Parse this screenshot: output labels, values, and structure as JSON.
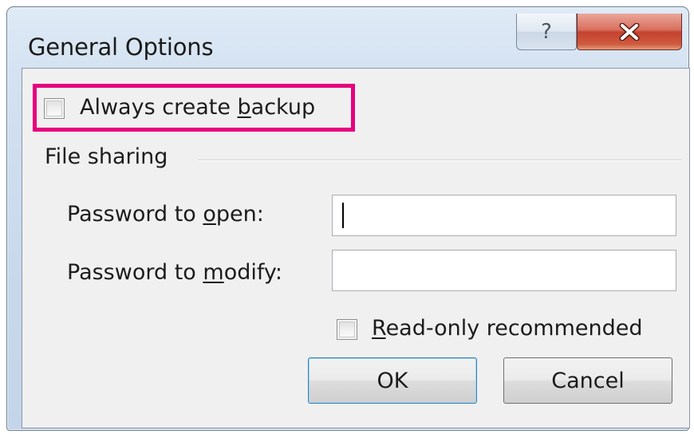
{
  "window": {
    "title": "General Options",
    "help_glyph": "?",
    "close_icon": "close-icon"
  },
  "backup": {
    "label_pre": "Always create ",
    "label_accel": "b",
    "label_post": "ackup",
    "checked": false,
    "highlight_color": "#e6007e"
  },
  "file_sharing": {
    "group_label": "File sharing",
    "password_open": {
      "label_pre": "Password to ",
      "label_accel": "o",
      "label_post": "pen:",
      "value": ""
    },
    "password_modify": {
      "label_pre": "Password to ",
      "label_accel": "m",
      "label_post": "odify:",
      "value": ""
    },
    "read_only": {
      "label_accel": "R",
      "label_post": "ead-only recommended",
      "checked": false
    }
  },
  "buttons": {
    "ok": "OK",
    "cancel": "Cancel"
  }
}
